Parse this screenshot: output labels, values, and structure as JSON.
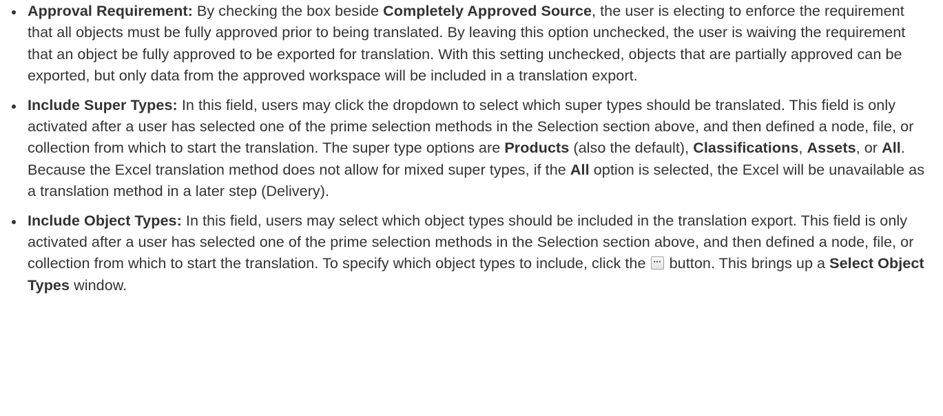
{
  "items": [
    {
      "parts": [
        {
          "text": "Approval Requirement:",
          "bold": true
        },
        {
          "text": " By checking the box beside ",
          "bold": false
        },
        {
          "text": "Completely Approved Source",
          "bold": true
        },
        {
          "text": ", the user is electing to enforce the requirement that all objects must be fully approved prior to being translated. By leaving this option unchecked, the user is waiving the requirement that an object be fully approved to be exported for translation. With this setting unchecked, objects that are partially approved can be exported, but only data from the approved workspace will be included in a translation export.",
          "bold": false
        }
      ]
    },
    {
      "parts": [
        {
          "text": "Include Super Types:",
          "bold": true
        },
        {
          "text": " In this field, users may click the dropdown to select which super types should be translated. This field is only activated after a user has selected one of the prime selection methods in the Selection section above, and then defined a node, file, or collection from which to start the translation. The super type options are ",
          "bold": false
        },
        {
          "text": "Products",
          "bold": true
        },
        {
          "text": " (also the default), ",
          "bold": false
        },
        {
          "text": "Classifications",
          "bold": true
        },
        {
          "text": ", ",
          "bold": false
        },
        {
          "text": "Assets",
          "bold": true
        },
        {
          "text": ", or ",
          "bold": false
        },
        {
          "text": "All",
          "bold": true
        },
        {
          "text": ". Because the Excel translation method does not allow for mixed super types, if the ",
          "bold": false
        },
        {
          "text": "All",
          "bold": true
        },
        {
          "text": " option is selected, the Excel will be unavailable as a translation method in a later step (Delivery).",
          "bold": false
        }
      ]
    },
    {
      "parts": [
        {
          "text": "Include Object Types:",
          "bold": true
        },
        {
          "text": " In this field, users may select which object types should be included in the translation export. This field is only activated after a user has selected one of the prime selection methods in the Selection section above, and then defined a node, file, or collection from which to start the translation. To specify which object types to include, click the ",
          "bold": false
        },
        {
          "text": " button. This brings up a ",
          "bold": false
        },
        {
          "text": "Select Object Types",
          "bold": true
        },
        {
          "text": " window.",
          "bold": false
        }
      ]
    }
  ],
  "ellipsis_button": {
    "icon": "ellipsis-icon",
    "glyph": "···"
  }
}
